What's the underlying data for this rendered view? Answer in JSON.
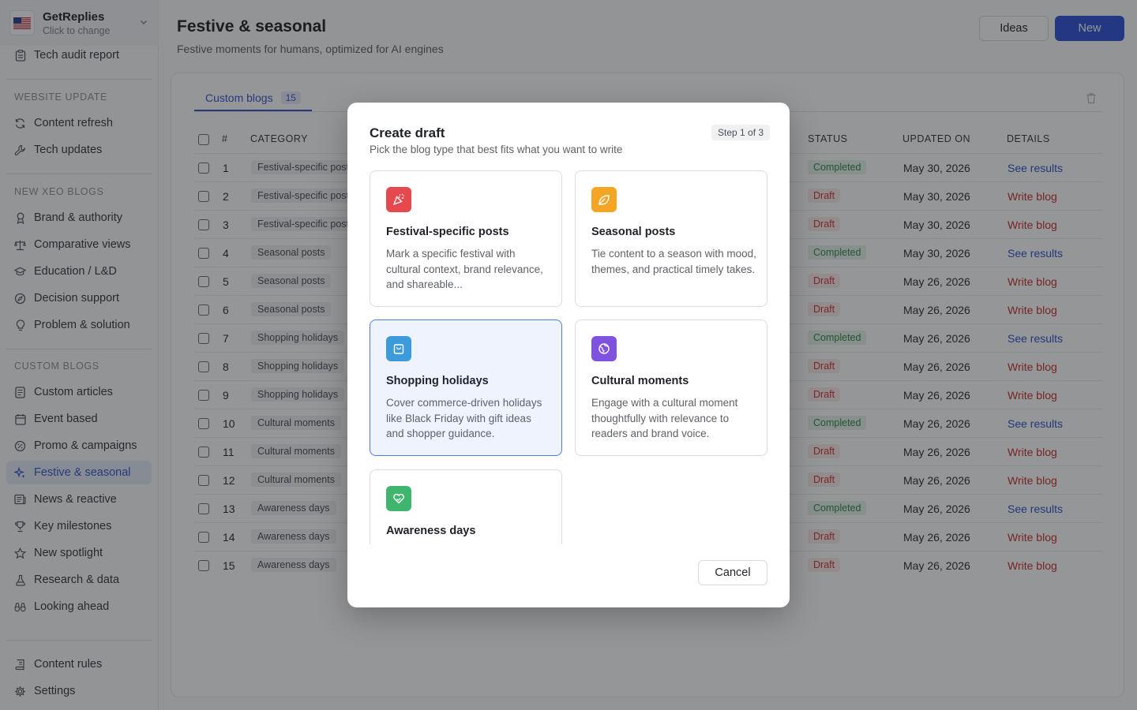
{
  "workspace": {
    "name": "GetReplies",
    "sub": "Click to change",
    "flag_icon": "us-flag-icon"
  },
  "sidebar": {
    "top_items": [
      {
        "label": "Tech audit report",
        "icon": "clipboard-icon"
      }
    ],
    "sections": [
      {
        "title": "WEBSITE UPDATE",
        "items": [
          {
            "label": "Content refresh",
            "icon": "refresh-icon"
          },
          {
            "label": "Tech updates",
            "icon": "wrench-icon"
          }
        ]
      },
      {
        "title": "NEW XEO BLOGS",
        "items": [
          {
            "label": "Brand & authority",
            "icon": "award-icon"
          },
          {
            "label": "Comparative views",
            "icon": "scale-icon"
          },
          {
            "label": "Education / L&D",
            "icon": "graduation-cap-icon"
          },
          {
            "label": "Decision support",
            "icon": "compass-icon"
          },
          {
            "label": "Problem & solution",
            "icon": "lightbulb-icon"
          }
        ]
      },
      {
        "title": "CUSTOM BLOGS",
        "items": [
          {
            "label": "Custom articles",
            "icon": "document-icon"
          },
          {
            "label": "Event based",
            "icon": "calendar-icon"
          },
          {
            "label": "Promo & campaigns",
            "icon": "percent-icon"
          },
          {
            "label": "Festive & seasonal",
            "icon": "sparkles-icon",
            "active": true
          },
          {
            "label": "News & reactive",
            "icon": "newspaper-icon"
          },
          {
            "label": "Key milestones",
            "icon": "trophy-icon"
          },
          {
            "label": "New spotlight",
            "icon": "star-icon"
          },
          {
            "label": "Research & data",
            "icon": "flask-icon"
          },
          {
            "label": "Looking ahead",
            "icon": "binoculars-icon"
          }
        ]
      }
    ],
    "bottom_items": [
      {
        "label": "Content rules",
        "icon": "rules-icon"
      },
      {
        "label": "Settings",
        "icon": "gear-icon"
      }
    ]
  },
  "header": {
    "title": "Festive & seasonal",
    "subtitle": "Festive moments for humans, optimized for AI engines",
    "ideas_label": "Ideas",
    "new_label": "New"
  },
  "tabs": [
    {
      "label": "Custom blogs",
      "count": "15"
    }
  ],
  "table": {
    "headers": {
      "num": "#",
      "category": "CATEGORY",
      "status": "STATUS",
      "updated": "UPDATED ON",
      "details": "DETAILS"
    },
    "rows": [
      {
        "num": "1",
        "category": "Festival-specific posts",
        "status": "Completed",
        "updated": "May 30, 2026",
        "details": "See results"
      },
      {
        "num": "2",
        "category": "Festival-specific posts",
        "status": "Draft",
        "updated": "May 30, 2026",
        "details": "Write blog"
      },
      {
        "num": "3",
        "category": "Festival-specific posts",
        "status": "Draft",
        "updated": "May 30, 2026",
        "details": "Write blog"
      },
      {
        "num": "4",
        "category": "Seasonal posts",
        "status": "Completed",
        "updated": "May 30, 2026",
        "details": "See results"
      },
      {
        "num": "5",
        "category": "Seasonal posts",
        "status": "Draft",
        "updated": "May 26, 2026",
        "details": "Write blog"
      },
      {
        "num": "6",
        "category": "Seasonal posts",
        "status": "Draft",
        "updated": "May 26, 2026",
        "details": "Write blog"
      },
      {
        "num": "7",
        "category": "Shopping holidays",
        "status": "Completed",
        "updated": "May 26, 2026",
        "details": "See results"
      },
      {
        "num": "8",
        "category": "Shopping holidays",
        "status": "Draft",
        "updated": "May 26, 2026",
        "details": "Write blog"
      },
      {
        "num": "9",
        "category": "Shopping holidays",
        "status": "Draft",
        "updated": "May 26, 2026",
        "details": "Write blog"
      },
      {
        "num": "10",
        "category": "Cultural moments",
        "status": "Completed",
        "updated": "May 26, 2026",
        "details": "See results"
      },
      {
        "num": "11",
        "category": "Cultural moments",
        "status": "Draft",
        "updated": "May 26, 2026",
        "details": "Write blog"
      },
      {
        "num": "12",
        "category": "Cultural moments",
        "status": "Draft",
        "updated": "May 26, 2026",
        "details": "Write blog"
      },
      {
        "num": "13",
        "category": "Awareness days",
        "status": "Completed",
        "updated": "May 26, 2026",
        "details": "See results"
      },
      {
        "num": "14",
        "category": "Awareness days",
        "status": "Draft",
        "updated": "May 26, 2026",
        "details": "Write blog"
      },
      {
        "num": "15",
        "category": "Awareness days",
        "status": "Draft",
        "updated": "May 26, 2026",
        "details": "Write blog"
      }
    ]
  },
  "modal": {
    "title": "Create draft",
    "subtitle": "Pick the blog type that best fits what you want to write",
    "step": "Step 1 of 3",
    "options": [
      {
        "title": "Festival-specific posts",
        "desc": "Mark a specific festival with cultural context, brand relevance, and shareable...",
        "icon": "party-popper-icon",
        "color": "#e5484d"
      },
      {
        "title": "Seasonal posts",
        "desc": "Tie content to a season with mood, themes, and practical timely takes.",
        "icon": "leaf-icon",
        "color": "#f5a524"
      },
      {
        "title": "Shopping holidays",
        "desc": "Cover commerce-driven holidays like Black Friday with gift ideas and shopper guidance.",
        "icon": "shopping-bag-icon",
        "color": "#3d9bdc",
        "selected": true
      },
      {
        "title": "Cultural moments",
        "desc": "Engage with a cultural moment thoughtfully with relevance to readers and brand voice.",
        "icon": "globe-icon",
        "color": "#8052e0"
      },
      {
        "title": "Awareness days",
        "desc": "",
        "icon": "heart-hand-icon",
        "color": "#3fb56d"
      }
    ],
    "cancel_label": "Cancel"
  },
  "colors": {
    "accent": "#3152d8",
    "completed": "#2f8a48",
    "draft": "#c93a3a",
    "link": "#2d56c9"
  }
}
